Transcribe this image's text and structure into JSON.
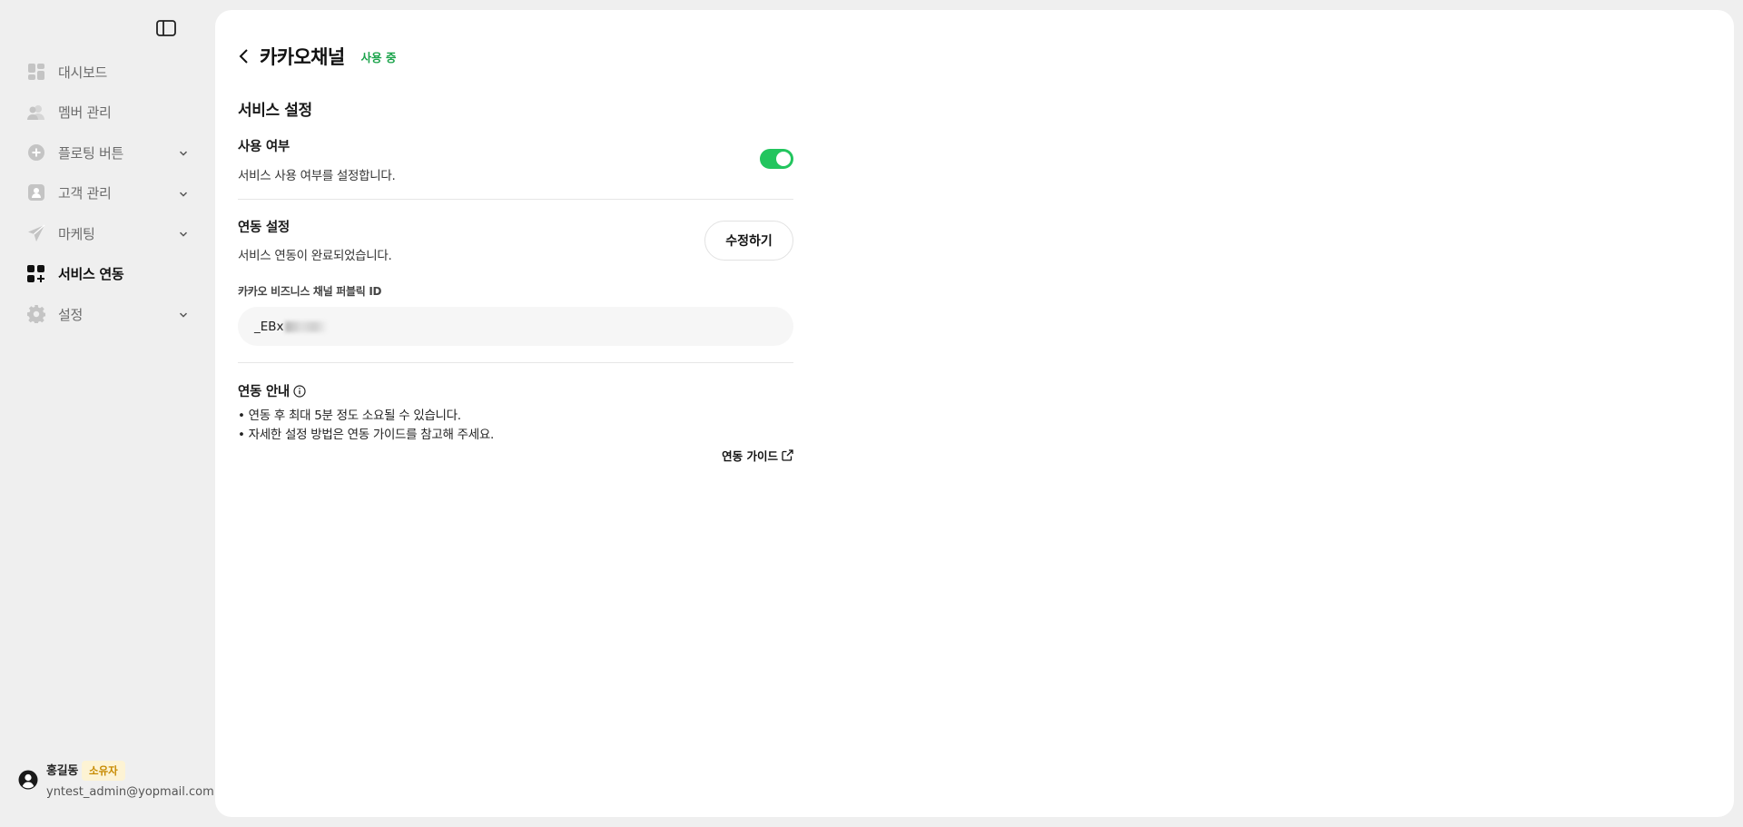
{
  "sidebar": {
    "items": [
      {
        "label": "대시보드",
        "icon": "dashboard-icon",
        "has_chevron": false
      },
      {
        "label": "멤버 관리",
        "icon": "members-icon",
        "has_chevron": false
      },
      {
        "label": "플로팅 버튼",
        "icon": "plus-circle-icon",
        "has_chevron": true
      },
      {
        "label": "고객 관리",
        "icon": "customer-icon",
        "has_chevron": true
      },
      {
        "label": "마케팅",
        "icon": "paper-plane-icon",
        "has_chevron": true
      },
      {
        "label": "서비스 연동",
        "icon": "apps-add-icon",
        "has_chevron": false,
        "active": true
      },
      {
        "label": "설정",
        "icon": "gear-icon",
        "has_chevron": true
      }
    ],
    "user": {
      "name": "홍길동",
      "role": "소유자",
      "email": "yntest_admin@yopmail.com"
    }
  },
  "page": {
    "title": "카카오채널",
    "status": "사용 중",
    "section_title": "서비스 설정",
    "usage": {
      "label": "사용 여부",
      "description": "서비스 사용 여부를 설정합니다.",
      "enabled": true
    },
    "integration": {
      "label": "연동 설정",
      "description": "서비스 연동이 완료되었습니다.",
      "edit_button": "수정하기",
      "field_label": "카카오 비즈니스 채널 퍼블릭 ID",
      "field_value_visible": "_EBx"
    },
    "guide": {
      "label": "연동 안내",
      "lines": [
        "• 연동 후 최대 5분 정도 소요될 수 있습니다.",
        "• 자세한 설정 방법은 연동 가이드를 참고해 주세요."
      ],
      "link_label": "연동 가이드"
    }
  },
  "colors": {
    "accent_green": "#22c55e",
    "status_green": "#1aa34a",
    "owner_badge_bg": "#fdf3d4",
    "owner_badge_text": "#c78a00"
  }
}
